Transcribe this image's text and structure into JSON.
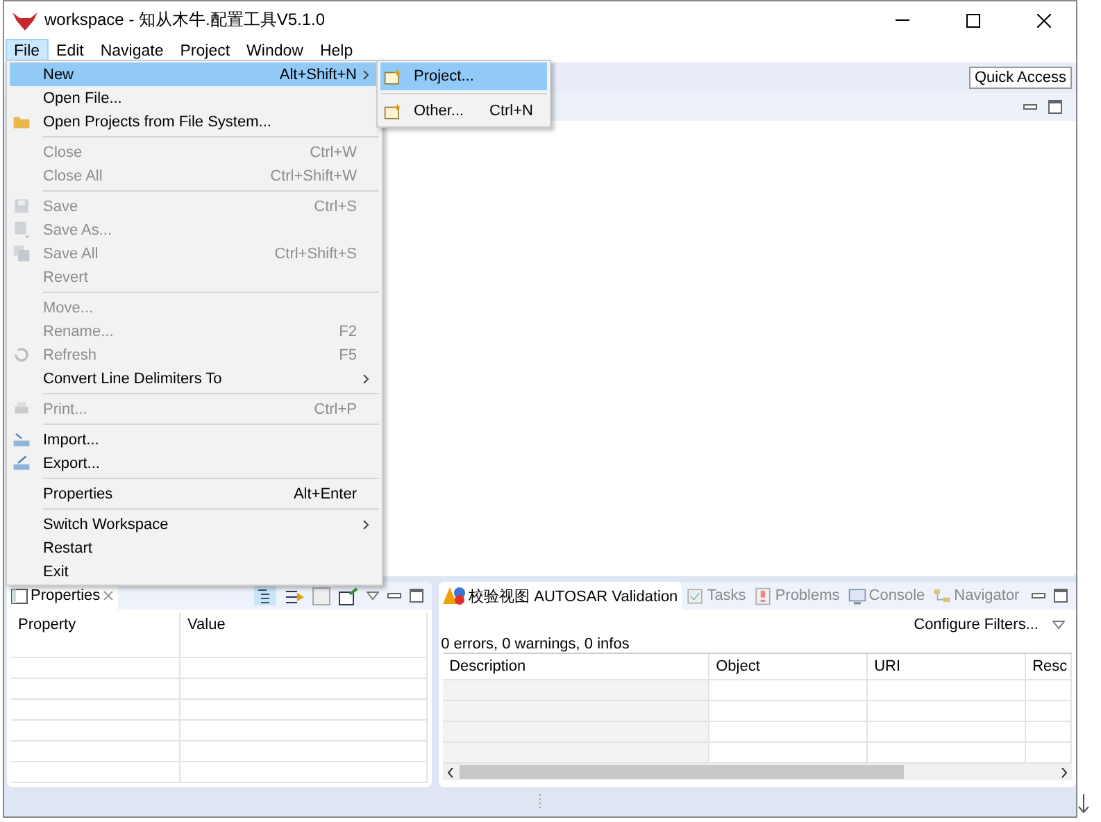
{
  "window": {
    "title": "workspace - 知从木牛.配置工具V5.1.0"
  },
  "menubar": [
    {
      "label": "File",
      "selected": true
    },
    {
      "label": "Edit",
      "selected": false
    },
    {
      "label": "Navigate",
      "selected": false
    },
    {
      "label": "Project",
      "selected": false
    },
    {
      "label": "Window",
      "selected": false
    },
    {
      "label": "Help",
      "selected": false
    }
  ],
  "quick_access": "Quick Access",
  "file_menu": [
    [
      {
        "label": "New",
        "shortcut": "Alt+Shift+N",
        "disabled": false,
        "submenu": true,
        "selected": true
      },
      {
        "label": "Open File...",
        "disabled": false,
        "submenu": false,
        "selected": false
      },
      {
        "label": "Open Projects from File System...",
        "disabled": false,
        "submenu": false,
        "selected": false
      }
    ],
    [
      {
        "label": "Close",
        "shortcut": "Ctrl+W",
        "disabled": true,
        "submenu": false,
        "selected": false
      },
      {
        "label": "Close All",
        "shortcut": "Ctrl+Shift+W",
        "disabled": true,
        "submenu": false,
        "selected": false
      }
    ],
    [
      {
        "label": "Save",
        "shortcut": "Ctrl+S",
        "disabled": true,
        "submenu": false,
        "selected": false
      },
      {
        "label": "Save As...",
        "disabled": true,
        "submenu": false,
        "selected": false
      },
      {
        "label": "Save All",
        "shortcut": "Ctrl+Shift+S",
        "disabled": true,
        "submenu": false,
        "selected": false
      },
      {
        "label": "Revert",
        "disabled": true,
        "submenu": false,
        "selected": false
      }
    ],
    [
      {
        "label": "Move...",
        "disabled": true,
        "submenu": false,
        "selected": false
      },
      {
        "label": "Rename...",
        "shortcut": "F2",
        "disabled": true,
        "submenu": false,
        "selected": false
      },
      {
        "label": "Refresh",
        "shortcut": "F5",
        "disabled": true,
        "submenu": false,
        "selected": false
      },
      {
        "label": "Convert Line Delimiters To",
        "disabled": false,
        "submenu": true,
        "selected": false
      }
    ],
    [
      {
        "label": "Print...",
        "shortcut": "Ctrl+P",
        "disabled": true,
        "submenu": false,
        "selected": false
      }
    ],
    [
      {
        "label": "Import...",
        "disabled": false,
        "submenu": false,
        "selected": false
      },
      {
        "label": "Export...",
        "disabled": false,
        "submenu": false,
        "selected": false
      }
    ],
    [
      {
        "label": "Properties",
        "shortcut": "Alt+Enter",
        "disabled": false,
        "submenu": false,
        "selected": false
      }
    ],
    [
      {
        "label": "Switch Workspace",
        "disabled": false,
        "submenu": true,
        "selected": false
      },
      {
        "label": "Restart",
        "disabled": false,
        "submenu": false,
        "selected": false
      },
      {
        "label": "Exit",
        "disabled": false,
        "submenu": false,
        "selected": false
      }
    ]
  ],
  "new_submenu": [
    [
      {
        "label": "Project...",
        "selected": true
      }
    ],
    [
      {
        "label": "Other...",
        "shortcut": "Ctrl+N",
        "selected": false
      }
    ]
  ],
  "properties_view": {
    "tab": "Properties",
    "columns": [
      "Property",
      "Value"
    ]
  },
  "validation_view": {
    "tabs": [
      {
        "label": "校验视图 AUTOSAR Validation",
        "selected": true
      },
      {
        "label": "Tasks",
        "selected": false
      },
      {
        "label": "Problems",
        "selected": false
      },
      {
        "label": "Console",
        "selected": false
      },
      {
        "label": "Navigator",
        "selected": false
      }
    ],
    "configure": "Configure Filters...",
    "summary": "0 errors, 0 warnings, 0 infos",
    "columns": [
      "Description",
      "Object",
      "URI",
      "Resc"
    ]
  }
}
